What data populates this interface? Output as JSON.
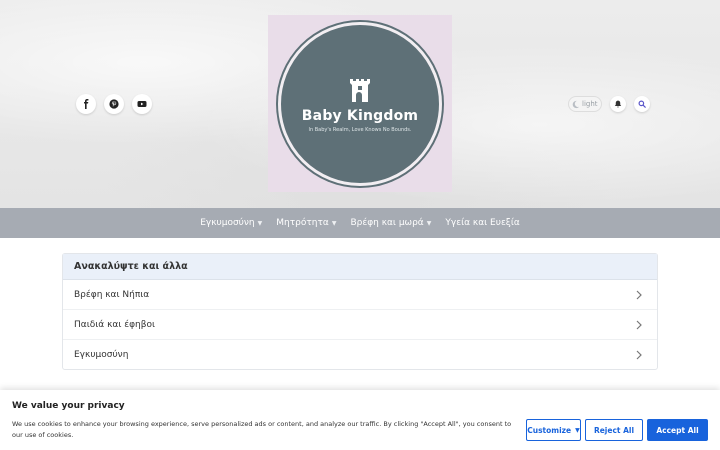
{
  "header": {
    "logo": {
      "title": "Baby Kingdom",
      "tagline": "In Baby's Realm, Love Knows No Bounds."
    },
    "social": [
      "facebook-icon",
      "pinterest-icon",
      "youtube-icon"
    ],
    "theme_toggle_label": "light"
  },
  "nav": {
    "items": [
      {
        "label": "Εγκυμοσύνη",
        "has_dropdown": true
      },
      {
        "label": "Μητρότητα",
        "has_dropdown": true
      },
      {
        "label": "Βρέφη και μωρά",
        "has_dropdown": true
      },
      {
        "label": "Υγεία και Ευεξία",
        "has_dropdown": false
      }
    ]
  },
  "discover": {
    "title": "Ανακαλύψτε και άλλα",
    "items": [
      {
        "label": "Βρέφη και Νήπια"
      },
      {
        "label": "Παιδιά και έφηβοι"
      },
      {
        "label": "Εγκυμοσύνη"
      }
    ]
  },
  "cookie": {
    "title": "We value your privacy",
    "text": "We use cookies to enhance your browsing experience, serve personalized ads or content, and analyze our traffic. By clicking \"Accept All\", you consent to our use of cookies.",
    "customize_label": "Customize",
    "reject_label": "Reject All",
    "accept_label": "Accept All"
  },
  "colors": {
    "nav_bg": "#a6abb3",
    "logo_bg": "#e9dde9",
    "logo_circle": "#5e7077",
    "accent": "#1863dc",
    "discover_head_bg": "#eaf0f9"
  }
}
